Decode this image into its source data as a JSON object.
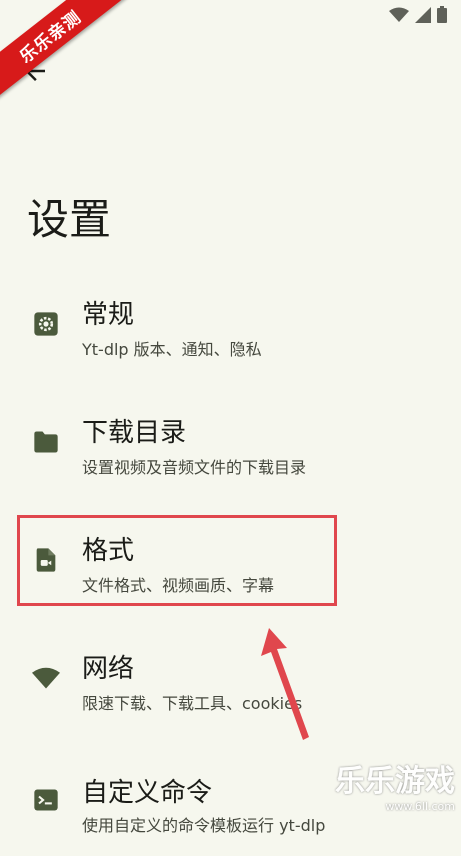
{
  "watermark": {
    "ribbon_text": "乐乐亲测",
    "logo_text": "乐乐游戏",
    "logo_url": "www.6ll.com"
  },
  "header": {
    "title": "设置"
  },
  "items": [
    {
      "title": "常规",
      "subtitle": "Yt-dlp 版本、通知、隐私",
      "icon": "gear-icon"
    },
    {
      "title": "下载目录",
      "subtitle": "设置视频及音频文件的下载目录",
      "icon": "folder-icon"
    },
    {
      "title": "格式",
      "subtitle": "文件格式、视频画质、字幕",
      "icon": "video-file-icon"
    },
    {
      "title": "网络",
      "subtitle": "限速下载、下载工具、cookies",
      "icon": "wifi-icon"
    },
    {
      "title": "自定义命令",
      "subtitle": "使用自定义的命令模板运行 yt-dlp",
      "icon": "terminal-icon"
    }
  ],
  "colors": {
    "background": "#f6f7ee",
    "icon": "#4b5a3c",
    "highlight": "#e0474d"
  }
}
